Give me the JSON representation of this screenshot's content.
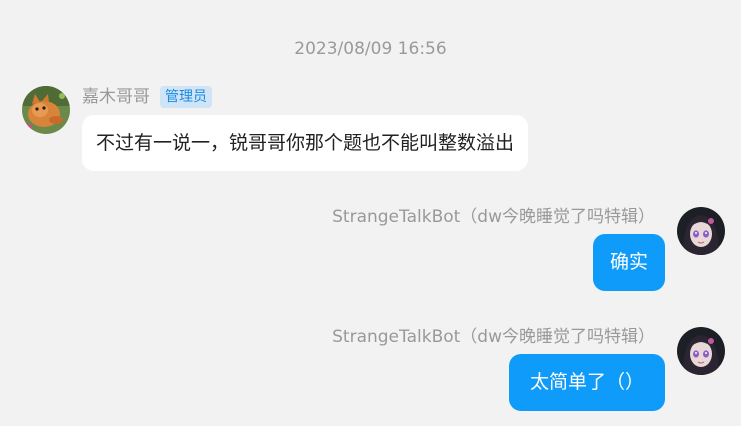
{
  "timestamp": "2023/08/09 16:56",
  "messages": [
    {
      "sender": "嘉木哥哥",
      "badge": "管理员",
      "text": "不过有一说一，锐哥哥你那个题也不能叫整数溢出",
      "avatar": "cat-avatar"
    },
    {
      "sender": "StrangeTalkBot（dw今晚睡觉了吗特辑）",
      "text": "确实",
      "avatar": "anime-girl-avatar"
    },
    {
      "sender": "StrangeTalkBot（dw今晚睡觉了吗特辑）",
      "text": "太简单了（）",
      "avatar": "anime-girl-avatar"
    }
  ],
  "colors": {
    "background": "#f2f2f2",
    "incoming_bubble": "#ffffff",
    "outgoing_bubble": "#0f9bf9",
    "badge_bg": "#cfe4f7",
    "badge_text": "#1c8ce0"
  }
}
